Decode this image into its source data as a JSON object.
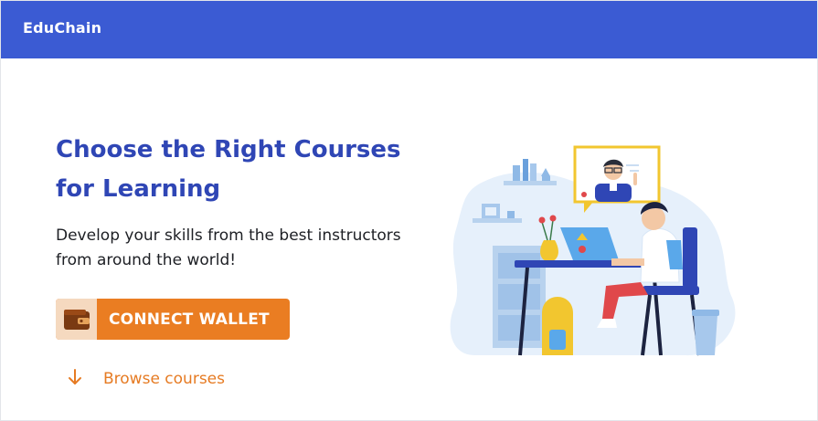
{
  "app": {
    "brand": "EduChain"
  },
  "hero": {
    "title_lines": [
      "Choose the Right Courses",
      "for Learning"
    ],
    "subtitle_lines": [
      "Develop your skills from the best instructors",
      "from around the world!"
    ]
  },
  "actions": {
    "connect_wallet_label": "CONNECT WALLET",
    "browse_label": "Browse courses"
  },
  "icons": {
    "wallet": "wallet-icon",
    "browse": "arrow-down-icon",
    "hero": "student-online-learning-illustration"
  },
  "colors": {
    "header": "#3b5bd3",
    "title": "#2f46b5",
    "accent": "#ea7d22",
    "accent_light": "#f5d9bf"
  }
}
